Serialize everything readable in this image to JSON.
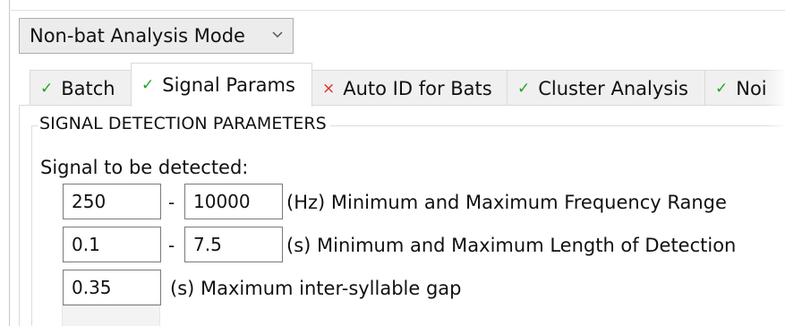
{
  "mode_select": {
    "value": "Non-bat Analysis Mode",
    "icon": "chevron-down-icon"
  },
  "tabs": [
    {
      "label": "Batch",
      "status": "ok",
      "mark": "✓",
      "active": false
    },
    {
      "label": "Signal Params",
      "status": "ok",
      "mark": "✓",
      "active": true
    },
    {
      "label": "Auto ID for Bats",
      "status": "error",
      "mark": "×",
      "active": false
    },
    {
      "label": "Cluster Analysis",
      "status": "ok",
      "mark": "✓",
      "active": false
    },
    {
      "label": "Noi",
      "status": "ok",
      "mark": "✓",
      "active": false
    }
  ],
  "colors": {
    "ok": "#1ea51e",
    "error": "#e02b2b",
    "tab_inactive": "#f0f0f0",
    "field_border": "#7a7a7a"
  },
  "signal_detection": {
    "group_title": "SIGNAL DETECTION PARAMETERS",
    "intro": "Signal to be detected:",
    "frequency": {
      "min": "250",
      "max": "10000",
      "separator": "-",
      "label": "(Hz) Minimum and Maximum Frequency Range"
    },
    "length": {
      "min": "0.1",
      "max": "7.5",
      "separator": "-",
      "label": "(s) Minimum and Maximum Length of Detection"
    },
    "gap": {
      "value": "0.35",
      "label": "(s) Maximum inter-syllable gap"
    }
  }
}
